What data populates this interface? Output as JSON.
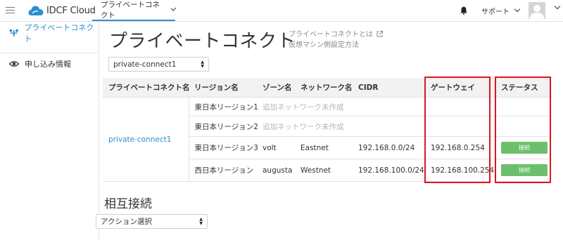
{
  "app": {
    "name": "IDCF Cloud"
  },
  "topnav": {
    "active_tab": "プライベートコネクト",
    "support": "サポート"
  },
  "sidebar": {
    "items": [
      {
        "label": "プライベートコネクト",
        "active": true
      },
      {
        "label": "申し込み情報",
        "active": false
      }
    ]
  },
  "main": {
    "title": "プライベートコネクト",
    "help_links": [
      "プライベートコネクトとは",
      "仮想マシン側設定方法"
    ],
    "connect_select": "private-connect1",
    "table": {
      "headers": [
        "プライベートコネクト名",
        "リージョン名",
        "ゾーン名",
        "ネットワーク名",
        "CIDR",
        "ゲートウェイ",
        "ステータス"
      ],
      "connect_name": "private-connect1",
      "rows": [
        {
          "region": "東日本リージョン1",
          "zone": "追加ネットワーク未作成",
          "network": "",
          "cidr": "",
          "gateway": "",
          "status": ""
        },
        {
          "region": "東日本リージョン2",
          "zone": "追加ネットワーク未作成",
          "network": "",
          "cidr": "",
          "gateway": "",
          "status": ""
        },
        {
          "region": "東日本リージョン3",
          "zone": "volt",
          "network": "Eastnet",
          "cidr": "192.168.0.0/24",
          "gateway": "192.168.0.254",
          "status": "接続"
        },
        {
          "region": "西日本リージョン",
          "zone": "augusta",
          "network": "Westnet",
          "cidr": "192.168.100.0/24",
          "gateway": "192.168.100.254",
          "status": "接続"
        }
      ]
    },
    "interconnect": {
      "title": "相互接続",
      "action_select": "アクション選択"
    }
  },
  "colors": {
    "accent": "#2b8fd0",
    "status_green": "#6cc06c",
    "highlight_red": "#e0141e"
  }
}
